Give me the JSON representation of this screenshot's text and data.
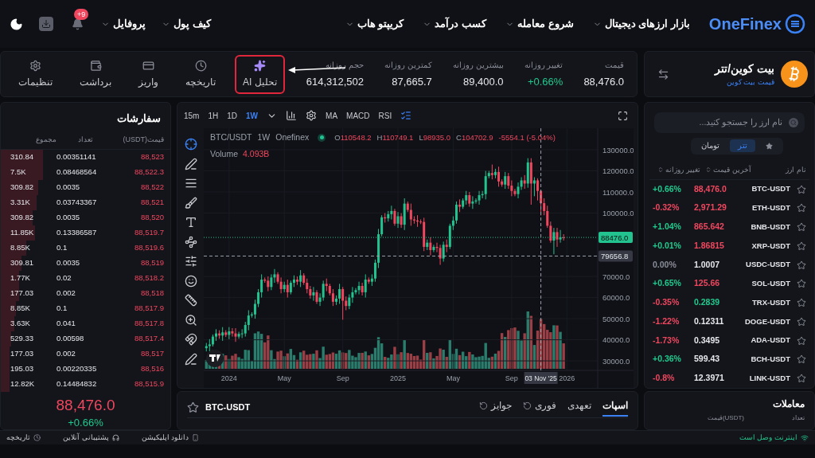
{
  "nav": {
    "logo": "OneFinex",
    "menu": [
      {
        "label": "بازار ارزهای دیجیتال"
      },
      {
        "label": "شروع معامله"
      },
      {
        "label": "کسب درآمد"
      },
      {
        "label": "کریپتو هاب"
      }
    ],
    "account": [
      {
        "label": "کیف پول"
      },
      {
        "label": "پروفایل"
      }
    ],
    "notification_badge": "+9"
  },
  "market_header": {
    "coin_name": "بیت کوین/تتر",
    "subtitle": "قیمت بیت کوین",
    "stats": {
      "price": {
        "label": "قیمت",
        "value": "88,476.0",
        "color": "#e5e7eb"
      },
      "daily_change": {
        "label": "تغییر روزانه",
        "value": "+0.66%",
        "color": "#20c98c"
      },
      "daily_high": {
        "label": "بیشترین روزانه",
        "value": "89,400.0",
        "color": "#e5e7eb"
      },
      "daily_low": {
        "label": "کمترین روزانه",
        "value": "87,665.7",
        "color": "#e5e7eb"
      },
      "daily_volume": {
        "label": "حجم روزانه",
        "value": "614,312,502",
        "color": "#e5e7eb"
      }
    },
    "tools": [
      {
        "kind": "ai",
        "label": "تحلیل AI",
        "highlighted": true
      },
      {
        "kind": "history",
        "label": "تاریخچه",
        "highlighted": false
      },
      {
        "kind": "deposit",
        "label": "واریز",
        "highlighted": false
      },
      {
        "kind": "withdraw",
        "label": "برداشت",
        "highlighted": false
      },
      {
        "kind": "settings",
        "label": "تنظیمات",
        "highlighted": false
      }
    ]
  },
  "order_book": {
    "title": "سفارشات",
    "columns": [
      "قیمت(USDT)",
      "تعداد",
      "مجموع"
    ],
    "rows": [
      {
        "price": "88,523",
        "amount": "0.00351141",
        "total": "310.84"
      },
      {
        "price": "88,522.3",
        "amount": "0.08468564",
        "total": "7.5K"
      },
      {
        "price": "88,522",
        "amount": "0.0035",
        "total": "309.82"
      },
      {
        "price": "88,521",
        "amount": "0.03743367",
        "total": "3.31K"
      },
      {
        "price": "88,520",
        "amount": "0.0035",
        "total": "309.82"
      },
      {
        "price": "88,519.7",
        "amount": "0.13386587",
        "total": "11.85K"
      },
      {
        "price": "88,519.6",
        "amount": "0.1",
        "total": "8.85K"
      },
      {
        "price": "88,519",
        "amount": "0.0035",
        "total": "309.81"
      },
      {
        "price": "88,518.2",
        "amount": "0.02",
        "total": "1.77K"
      },
      {
        "price": "88,518",
        "amount": "0.002",
        "total": "177.03"
      },
      {
        "price": "88,517.9",
        "amount": "0.1",
        "total": "8.85K"
      },
      {
        "price": "88,517.8",
        "amount": "0.041",
        "total": "3.63K"
      },
      {
        "price": "88,517.4",
        "amount": "0.00598",
        "total": "529.33"
      },
      {
        "price": "88,517",
        "amount": "0.002",
        "total": "177.03"
      },
      {
        "price": "88,516",
        "amount": "0.00220335",
        "total": "195.03"
      },
      {
        "price": "88,515.9",
        "amount": "0.14484832",
        "total": "12.82K"
      }
    ],
    "last_price": "88,476.0",
    "last_change": "+0.66%"
  },
  "chart_toolbar": {
    "intervals": [
      {
        "label": "15m",
        "selected": false
      },
      {
        "label": "1H",
        "selected": false
      },
      {
        "label": "1D",
        "selected": false
      },
      {
        "label": "1W",
        "selected": true
      }
    ],
    "indicators": [
      "MA",
      "MACD",
      "RSI"
    ]
  },
  "chart": {
    "symbol": "BTC/USDT",
    "interval": "1W",
    "source": "Onefinex",
    "ohlc": [
      {
        "key": "O",
        "value": "110548.2"
      },
      {
        "key": "H",
        "value": "110749.1"
      },
      {
        "key": "L",
        "value": "98935.0"
      },
      {
        "key": "C",
        "value": "104702.9"
      }
    ],
    "change": "-5554.1 (-5.04%)",
    "volume_label": "Volume",
    "volume_value": "4.093B",
    "crosshair_date": "03 Nov '25",
    "chart_data": {
      "type": "candlestick",
      "grid": true,
      "ylim": [
        25500,
        140200
      ],
      "ref_lines": [
        {
          "axis": "y",
          "value": 88476,
          "label": "88476.0",
          "color": "#22c38e"
        },
        {
          "axis": "y",
          "value": 79656.8,
          "label": "79656.8",
          "color": "#9aa0aa"
        }
      ],
      "yticks": [
        {
          "value": 130000,
          "label": "130000.0"
        },
        {
          "value": 120000,
          "label": "120000.0"
        },
        {
          "value": 110000,
          "label": "110000.0"
        },
        {
          "value": 100000,
          "label": "100000.0"
        },
        {
          "value": 70000,
          "label": "70000.0"
        },
        {
          "value": 60000,
          "label": "60000.0"
        },
        {
          "value": 50000,
          "label": "50000.0"
        },
        {
          "value": 40000,
          "label": "40000.0"
        },
        {
          "value": 30000,
          "label": "30000.0"
        }
      ],
      "categories": [
        null,
        null,
        null,
        null,
        null,
        null,
        null,
        "2024",
        null,
        null,
        null,
        null,
        null,
        null,
        null,
        null,
        null,
        null,
        null,
        null,
        null,
        null,
        null,
        null,
        "May",
        null,
        null,
        null,
        null,
        null,
        null,
        null,
        null,
        null,
        null,
        null,
        null,
        null,
        null,
        null,
        null,
        null,
        "Sep",
        null,
        null,
        null,
        null,
        null,
        null,
        null,
        null,
        null,
        null,
        null,
        null,
        null,
        null,
        null,
        null,
        "2025",
        null,
        null,
        null,
        null,
        null,
        null,
        null,
        null,
        null,
        null,
        null,
        null,
        null,
        null,
        null,
        null,
        "May",
        null,
        null,
        null,
        null,
        null,
        null,
        null,
        null,
        null,
        null,
        null,
        null,
        null,
        null,
        null,
        null,
        null,
        "Sep",
        null,
        null,
        null,
        null,
        null,
        null,
        null,
        null,
        null,
        null,
        null,
        null,
        null,
        null,
        null,
        null,
        "2026"
      ],
      "ohlc": [
        [
          36000,
          38500,
          34500,
          37000
        ],
        [
          37000,
          40300,
          34500,
          37800
        ],
        [
          37800,
          42500,
          36800,
          41500
        ],
        [
          41500,
          45000,
          39500,
          43000
        ],
        [
          43000,
          44500,
          40500,
          42000
        ],
        [
          42000,
          46000,
          39500,
          43500
        ],
        [
          43500,
          44500,
          41300,
          42300
        ],
        [
          42300,
          46000,
          40300,
          44000
        ],
        [
          44000,
          45500,
          41500,
          43000
        ],
        [
          43000,
          45500,
          39000,
          41500
        ],
        [
          41500,
          43800,
          40500,
          42800
        ],
        [
          42800,
          45000,
          40800,
          43000
        ],
        [
          43000,
          48500,
          41500,
          47000
        ],
        [
          47000,
          54000,
          44500,
          51500
        ],
        [
          51500,
          53000,
          50500,
          52000
        ],
        [
          52000,
          59000,
          50000,
          57000
        ],
        [
          57000,
          64000,
          55500,
          62500
        ],
        [
          62500,
          71000,
          60000,
          68500
        ],
        [
          68500,
          69500,
          67000,
          68000
        ],
        [
          68000,
          70000,
          63000,
          65000
        ],
        [
          65000,
          71000,
          63500,
          69500
        ],
        [
          69500,
          73500,
          67000,
          71000
        ],
        [
          71000,
          72000,
          66500,
          67500
        ],
        [
          67500,
          69500,
          62000,
          64000
        ],
        [
          64000,
          67500,
          62500,
          66000
        ],
        [
          66000,
          68500,
          60000,
          62500
        ],
        [
          62500,
          68000,
          61500,
          67000
        ],
        [
          67000,
          70500,
          65000,
          68500
        ],
        [
          68500,
          70000,
          66000,
          67500
        ],
        [
          67500,
          73000,
          65000,
          70500
        ],
        [
          70500,
          71500,
          66000,
          67000
        ],
        [
          67000,
          69000,
          62000,
          64000
        ],
        [
          64000,
          65500,
          59500,
          61000
        ],
        [
          61000,
          65000,
          58500,
          62500
        ],
        [
          62500,
          63500,
          57000,
          58000
        ],
        [
          58000,
          62000,
          56000,
          60000
        ],
        [
          60000,
          68000,
          58500,
          66500
        ],
        [
          66500,
          69000,
          63000,
          65500
        ],
        [
          65500,
          66500,
          61000,
          62000
        ],
        [
          62000,
          64000,
          56000,
          58000
        ],
        [
          58000,
          61000,
          56500,
          59500
        ],
        [
          59500,
          66500,
          57000,
          64000
        ],
        [
          64000,
          65000,
          49500,
          58500
        ],
        [
          58500,
          60500,
          54000,
          56000
        ],
        [
          56000,
          61500,
          54500,
          60000
        ],
        [
          60000,
          65000,
          57500,
          62500
        ],
        [
          62500,
          64500,
          61500,
          63500
        ],
        [
          63500,
          67500,
          61500,
          65500
        ],
        [
          65500,
          67000,
          61000,
          62500
        ],
        [
          62500,
          71000,
          60000,
          68500
        ],
        [
          68500,
          69500,
          66500,
          67500
        ],
        [
          67500,
          71000,
          65500,
          69000
        ],
        [
          69000,
          78000,
          67500,
          76500
        ],
        [
          76500,
          92500,
          74000,
          90000
        ],
        [
          90000,
          99000,
          89000,
          98000
        ],
        [
          98000,
          100000,
          95500,
          97500
        ],
        [
          97500,
          101000,
          96000,
          99500
        ],
        [
          99500,
          103500,
          97000,
          101000
        ],
        [
          101000,
          102000,
          94000,
          95000
        ],
        [
          95000,
          100500,
          93000,
          98500
        ],
        [
          98500,
          100000,
          93000,
          94500
        ],
        [
          94500,
          107000,
          92000,
          104500
        ],
        [
          104500,
          105500,
          100500,
          101500
        ],
        [
          101500,
          104500,
          94000,
          97000
        ],
        [
          97000,
          98500,
          95000,
          96500
        ],
        [
          96500,
          99000,
          93500,
          96000
        ],
        [
          96000,
          97000,
          94800,
          95800
        ],
        [
          95800,
          97800,
          82000,
          84000
        ],
        [
          84000,
          87500,
          82500,
          86000
        ],
        [
          86000,
          88500,
          80000,
          82500
        ],
        [
          82500,
          85000,
          81500,
          84000
        ],
        [
          84000,
          86000,
          81500,
          83500
        ],
        [
          83500,
          85000,
          75500,
          78500
        ],
        [
          78500,
          86500,
          77000,
          85000
        ],
        [
          85000,
          87500,
          81500,
          84000
        ],
        [
          84000,
          95000,
          83000,
          94000
        ],
        [
          94000,
          98500,
          92000,
          96500
        ],
        [
          96500,
          105500,
          95000,
          104000
        ],
        [
          104000,
          106500,
          100500,
          103000
        ],
        [
          103000,
          107000,
          102000,
          106000
        ],
        [
          106000,
          110500,
          104000,
          108500
        ],
        [
          108500,
          110000,
          103000,
          104500
        ],
        [
          104500,
          108000,
          102000,
          105500
        ],
        [
          105500,
          107000,
          104500,
          106000
        ],
        [
          106000,
          110500,
          104000,
          108500
        ],
        [
          108500,
          110500,
          107000,
          109000
        ],
        [
          109000,
          120000,
          106500,
          117500
        ],
        [
          117500,
          120000,
          116500,
          119000
        ],
        [
          119000,
          123000,
          116000,
          118000
        ],
        [
          118000,
          121000,
          116500,
          119500
        ],
        [
          119500,
          122000,
          112500,
          115000
        ],
        [
          115000,
          116000,
          112500,
          113500
        ],
        [
          113500,
          119500,
          111500,
          117500
        ],
        [
          117500,
          119000,
          111500,
          113000
        ],
        [
          113000,
          115500,
          108000,
          110500
        ],
        [
          110500,
          111500,
          108000,
          109000
        ],
        [
          109000,
          114500,
          107000,
          112500
        ],
        [
          112500,
          117000,
          111000,
          115500
        ],
        [
          115500,
          118000,
          111500,
          114000
        ],
        [
          114000,
          126000,
          112000,
          124000
        ],
        [
          124000,
          126000,
          104000,
          114000
        ],
        [
          114000,
          117000,
          108000,
          115500
        ],
        [
          115500,
          116500,
          106000,
          110500
        ],
        [
          110500,
          110700,
          98900,
          104700
        ],
        [
          104700,
          107000,
          99000,
          101000
        ],
        [
          101000,
          103500,
          93000,
          94000
        ],
        [
          94000,
          96000,
          86000,
          87000
        ],
        [
          87000,
          93000,
          80500,
          91000
        ],
        [
          91000,
          93000,
          84000,
          87500
        ],
        [
          87500,
          92000,
          86000,
          88500
        ],
        [
          88500,
          90000,
          87000,
          88476
        ],
        null
      ]
    }
  },
  "trade_panel": {
    "symbol": "BTC-USDT",
    "tabs": [
      {
        "label": "اسپات",
        "kind": "plain",
        "selected": true
      },
      {
        "label": "تعهدی",
        "kind": "plain",
        "selected": false
      },
      {
        "label": "فوری",
        "kind": "with_icon",
        "selected": false
      },
      {
        "label": "جوایز",
        "kind": "with_icon",
        "selected": false
      }
    ]
  },
  "market_list": {
    "search": {
      "placeholder": "نام ارز را جستجو کنید..."
    },
    "segments": [
      {
        "kind": "favorites",
        "selected": false
      },
      {
        "kind": "text",
        "label": "تتر",
        "selected": true
      },
      {
        "kind": "text",
        "label": "تومان",
        "selected": false
      }
    ],
    "columns": [
      "نام ارز",
      "آخرین قیمت",
      "تغییر روزانه"
    ],
    "rows": [
      {
        "name": "BTC-USDT",
        "price": {
          "text": "88,476.0",
          "color": "#f0475e"
        },
        "change": {
          "text": "+0.66%",
          "color": "#20c98c"
        }
      },
      {
        "name": "ETH-USDT",
        "price": {
          "text": "2,971.29",
          "color": "#f0475e"
        },
        "change": {
          "text": "-0.32%",
          "color": "#f0475e"
        }
      },
      {
        "name": "BNB-USDT",
        "price": {
          "text": "865.642",
          "color": "#f0475e"
        },
        "change": {
          "text": "+1.04%",
          "color": "#20c98c"
        }
      },
      {
        "name": "XRP-USDT",
        "price": {
          "text": "1.86815",
          "color": "#f0475e"
        },
        "change": {
          "text": "+0.01%",
          "color": "#20c98c"
        }
      },
      {
        "name": "USDC-USDT",
        "price": {
          "text": "1.0007",
          "color": "#e5e7eb"
        },
        "change": {
          "text": "0.00%",
          "color": "#8b8e98"
        }
      },
      {
        "name": "SOL-USDT",
        "price": {
          "text": "125.66",
          "color": "#f0475e"
        },
        "change": {
          "text": "+0.65%",
          "color": "#20c98c"
        }
      },
      {
        "name": "TRX-USDT",
        "price": {
          "text": "0.2839",
          "color": "#20c98c"
        },
        "change": {
          "text": "-0.35%",
          "color": "#f0475e"
        }
      },
      {
        "name": "DOGE-USDT",
        "price": {
          "text": "0.12311",
          "color": "#e5e7eb"
        },
        "change": {
          "text": "-1.22%",
          "color": "#f0475e"
        }
      },
      {
        "name": "ADA-USDT",
        "price": {
          "text": "0.3495",
          "color": "#e5e7eb"
        },
        "change": {
          "text": "-1.73%",
          "color": "#f0475e"
        }
      },
      {
        "name": "BCH-USDT",
        "price": {
          "text": "599.43",
          "color": "#e5e7eb"
        },
        "change": {
          "text": "+0.36%",
          "color": "#20c98c"
        }
      },
      {
        "name": "LINK-USDT",
        "price": {
          "text": "12.3971",
          "color": "#e5e7eb"
        },
        "change": {
          "text": "-0.8%",
          "color": "#f0475e"
        }
      }
    ]
  },
  "trades": {
    "title": "معاملات",
    "columns": {
      "amount": "تعداد",
      "price": "قیمت(USDT)"
    }
  },
  "status_bar": {
    "links": [
      {
        "kind": "download",
        "label": "دانلود اپلیکیشن"
      },
      {
        "kind": "support",
        "label": "پشتیبانی آنلاین"
      },
      {
        "kind": "history",
        "label": "تاریخچه"
      }
    ],
    "connection": "اینترنت وصل است"
  }
}
